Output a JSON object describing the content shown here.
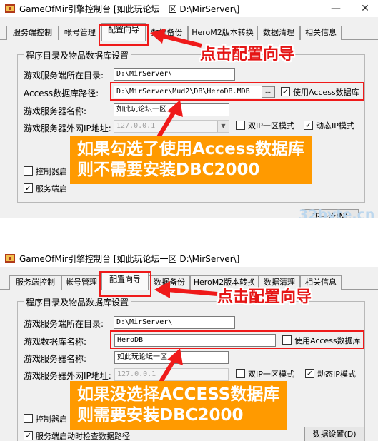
{
  "window": {
    "title": "GameOfMir引擎控制台 [如此玩论坛一区 D:\\MirServer\\]",
    "minimize_glyph": "—",
    "close_glyph": "✕",
    "icon": "app-icon"
  },
  "tabs": [
    "服务端控制",
    "帐号管理",
    "配置向导",
    "数据备份",
    "HeroM2版本转换",
    "数据清理",
    "相关信息"
  ],
  "active_tab": "配置向导",
  "group_title": "程序目录及物品数据库设置",
  "screenshot_1": {
    "server_dir_label": "游戏服务端所在目录:",
    "server_dir_value": "D:\\MirServer\\",
    "db_path_label": "Access数据库路径:",
    "db_path_value": "D:\\MirServer\\Mud2\\DB\\HeroDB.MDB",
    "browse_label": "...",
    "use_access_label": "使用Access数据库",
    "use_access_checked": true,
    "server_name_label": "游戏服务器名称:",
    "server_name_value": "如此玩论坛一区",
    "server_ip_label": "游戏服务器外网IP地址:",
    "server_ip_value": "127.0.0.1",
    "dual_ip_label": "双IP一区模式",
    "dual_ip_checked": false,
    "dynamic_ip_label": "动态IP模式",
    "dynamic_ip_checked": true,
    "control_partial": "控制器启",
    "server_partial": "服务端启",
    "next_partial": "下一步(N)",
    "annotation": "点击配置向导",
    "callout_line1": "如果勾选了使用Access数据库",
    "callout_line2": "则不需要安装DBC2000",
    "watermark": "32byte.cn"
  },
  "screenshot_2": {
    "server_dir_label": "游戏服务端所在目录:",
    "server_dir_value": "D:\\MirServer\\",
    "db_name_label": "游戏数据库名称:",
    "db_name_value": "HeroDB",
    "use_access_label": "使用Access数据库",
    "use_access_checked": false,
    "server_name_label": "游戏服务器名称:",
    "server_name_value": "如此玩论坛一区",
    "server_ip_label": "游戏服务器外网IP地址:",
    "server_ip_value": "127.0.0.1",
    "dual_ip_label": "双IP一区模式",
    "dual_ip_checked": false,
    "dynamic_ip_label": "动态IP模式",
    "dynamic_ip_checked": true,
    "control_partial": "控制器启",
    "bottom_partial": "服务端启动时检查数据路径",
    "next_partial": "数据设置(D)",
    "annotation": "点击配置向导",
    "callout_line1": "如果没选择ACCESS数据库",
    "callout_line2": "则需要安装DBC2000"
  },
  "colors": {
    "highlight": "#ef1a1a",
    "annotation": "#e51515",
    "callout_bg": "#ff9a00",
    "window_bg": "#f0f0f0"
  },
  "check_glyph": "✓",
  "dropdown_glyph": "▼"
}
